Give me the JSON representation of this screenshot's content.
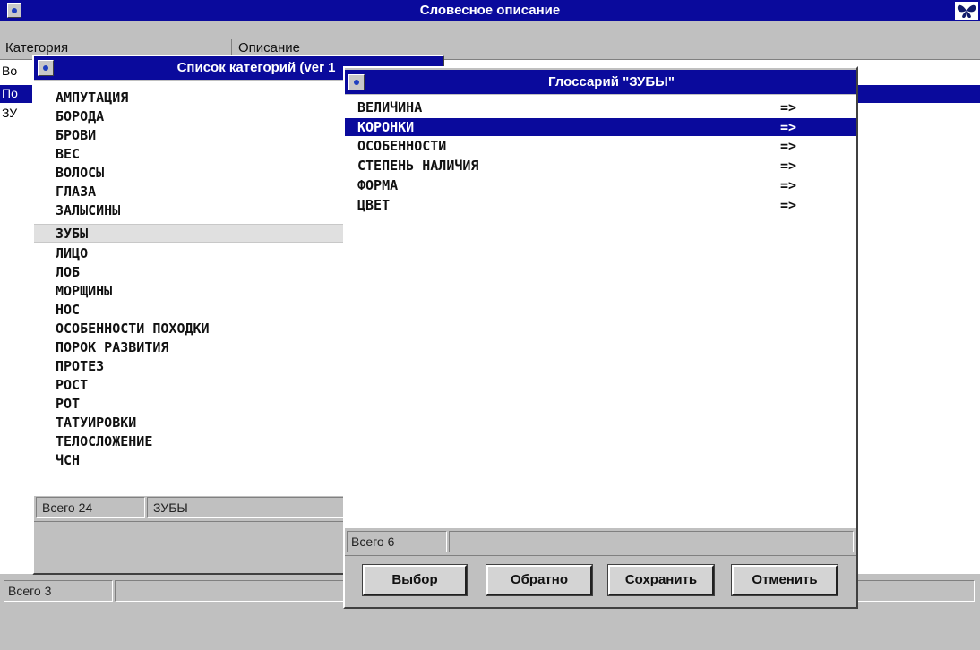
{
  "main_window": {
    "title": "Словесное описание",
    "col_category": "Категория",
    "col_description": "Описание",
    "rows": [
      "Во",
      "По",
      "ЗУ"
    ],
    "status_total": "Всего 3"
  },
  "categories_window": {
    "title": "Список категорий (ver 1",
    "items": [
      "АМПУТАЦИЯ",
      "БОРОДА",
      "БРОВИ",
      "ВЕС",
      "ВОЛОСЫ",
      "ГЛАЗА",
      "ЗАЛЫСИНЫ",
      "ЗУБЫ",
      "ЛИЦО",
      "ЛОБ",
      "МОРЩИНЫ",
      "НОС",
      "ОСОБЕННОСТИ ПОХОДКИ",
      "ПОРОК РАЗВИТИЯ",
      "ПРОТЕЗ",
      "РОСТ",
      "РОТ",
      "ТАТУИРОВКИ",
      "ТЕЛОСЛОЖЕНИЕ",
      "ЧСН"
    ],
    "selected_index": 7,
    "status_total": "Всего 24",
    "status_current": "ЗУБЫ"
  },
  "glossary_window": {
    "title": "Глоссарий \"ЗУБЫ\"",
    "items": [
      {
        "label": "ВЕЛИЧИНА",
        "arrow": "=>"
      },
      {
        "label": "КОРОНКИ",
        "arrow": "=>"
      },
      {
        "label": "ОСОБЕННОСТИ",
        "arrow": "=>"
      },
      {
        "label": "СТЕПЕНЬ НАЛИЧИЯ",
        "arrow": "=>"
      },
      {
        "label": "ФОРМА",
        "arrow": "=>"
      },
      {
        "label": "ЦВЕТ",
        "arrow": "=>"
      }
    ],
    "selected_index": 1,
    "status_total": "Всего 6",
    "buttons": {
      "select": "Выбор",
      "back": "Обратно",
      "save": "Сохранить",
      "cancel": "Отменить"
    }
  },
  "icons": {
    "app_icon": "butterfly-icon",
    "system_menu": "system-menu-icon"
  },
  "colors": {
    "titlebar": "#0a0a9c",
    "selection": "#0a0a9c",
    "face": "#c0c0c0"
  }
}
